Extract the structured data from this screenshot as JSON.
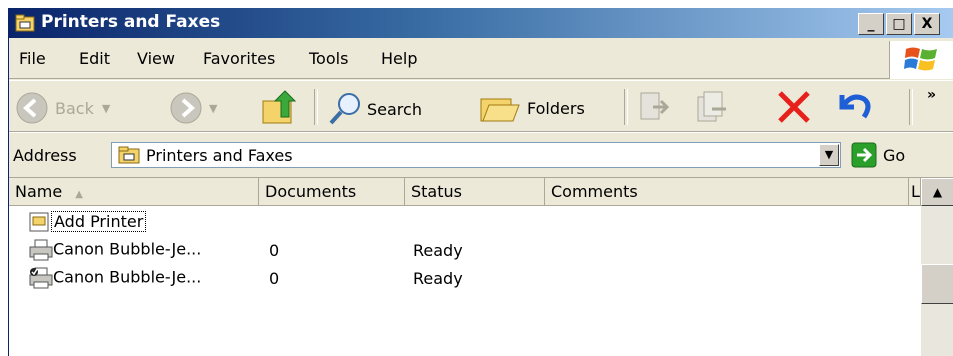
{
  "window": {
    "title": "Printers and Faxes",
    "minimize": "_",
    "maximize": "□",
    "close": "X"
  },
  "menu": [
    "File",
    "Edit",
    "View",
    "Favorites",
    "Tools",
    "Help"
  ],
  "toolbar": {
    "back": "Back",
    "search": "Search",
    "folders": "Folders",
    "overflow": "»"
  },
  "address": {
    "label": "Address",
    "value": "Printers and Faxes",
    "go": "Go"
  },
  "columns": [
    "Name",
    "Documents",
    "Status",
    "Comments",
    "L"
  ],
  "rows": [
    {
      "name": "Add Printer",
      "documents": "",
      "status": ""
    },
    {
      "name": "Canon Bubble-Je...",
      "documents": "0",
      "status": "Ready"
    },
    {
      "name": "Canon Bubble-Je...",
      "documents": "0",
      "status": "Ready"
    }
  ],
  "colors": {
    "title_start": "#0a246a",
    "title_end": "#a6caf0",
    "face": "#ece9d8",
    "delete_red": "#e8201c",
    "undo_blue": "#1f5fd6",
    "go_green": "#2aa02a"
  }
}
